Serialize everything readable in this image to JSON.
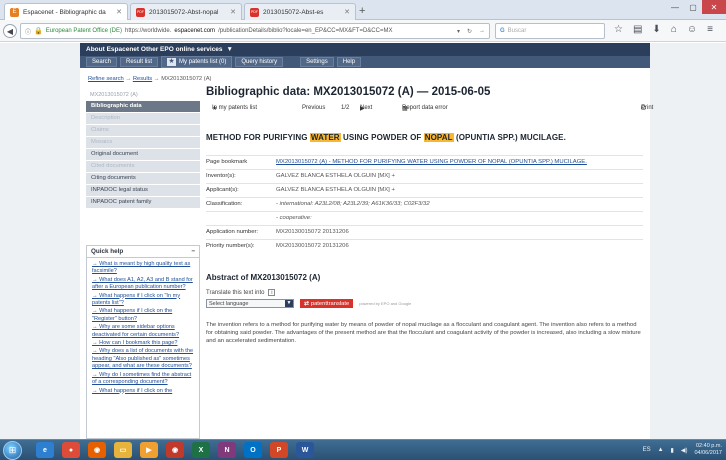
{
  "browser": {
    "tabs": [
      {
        "title": "Espacenet - Bibliographic da",
        "favicon_color": "#e67e22",
        "favicon_letter": "E"
      },
      {
        "title": "2013015072-Abst-nopal",
        "favicon_color": "#d8322b",
        "favicon_letter": "PDF"
      },
      {
        "title": "2013015072-Abst-es",
        "favicon_color": "#d8322b",
        "favicon_letter": "PDF"
      }
    ],
    "new_tab": "+",
    "address": {
      "org": "European Patent Office (DE)",
      "prefix": "https://worldwide.",
      "host": "espacenet.com",
      "rest": "/publicationDetails/biblio?locale=en_EP&CC=MX&FT=D&CC=MX"
    },
    "search_placeholder": "Buscar",
    "search_engine_glyph": "G",
    "toolbar_icons": [
      "☆",
      "▤",
      "⬇",
      "⌂",
      "☺",
      "≡"
    ]
  },
  "espacenet": {
    "top_menu": "About Espacenet   Other EPO online services",
    "sub_menu": [
      "Search",
      "Result list",
      "My patents list (0)",
      "Query history",
      "Settings",
      "Help"
    ],
    "breadcrumb": {
      "refine": "Refine search",
      "results": "Results",
      "current": "MX2013015072 (A)"
    },
    "sidebar": {
      "heading": "MX2013015072 (A)",
      "items": [
        {
          "label": "Bibliographic data",
          "state": "active"
        },
        {
          "label": "Description",
          "state": "disabled"
        },
        {
          "label": "Claims",
          "state": "disabled"
        },
        {
          "label": "Mosaics",
          "state": "disabled"
        },
        {
          "label": "Original document",
          "state": "normal"
        },
        {
          "label": "Cited documents",
          "state": "disabled"
        },
        {
          "label": "Citing documents",
          "state": "normal"
        },
        {
          "label": "INPADOC legal status",
          "state": "normal"
        },
        {
          "label": "INPADOC patent family",
          "state": "normal"
        }
      ]
    },
    "quick_help": {
      "title": "Quick help",
      "collapse": "−",
      "links": [
        "What is meant by high quality text as facsimile?",
        "What does A1, A2, A3 and B stand for after a European publication number?",
        "What happens if I click on \"In my patents list\"?",
        "What happens if I click on the \"Register\" button?",
        "Why are some sidebar options deactivated for certain documents?",
        "How can I bookmark this page?",
        "Why does a list of documents with the heading \"Also published as\" sometimes appear, and what are these documents?",
        "Why do I sometimes find the abstract of a corresponding document?",
        "What happens if I click on the"
      ]
    },
    "page_title": "Bibliographic data: MX2013015072 (A) — 2015-06-05",
    "actions": {
      "add_to_list": "In my patents list",
      "previous": "Previous",
      "pager": "1/2",
      "next": "Next",
      "report": "Report data error",
      "print": "Print"
    },
    "invention_title": {
      "part1": "METHOD FOR PURIFYING ",
      "hl1": "WATER",
      "part2": " USING POWDER OF ",
      "hl2": "NOPAL",
      "part3": " (OPUNTIA SPP.) MUCILAGE."
    },
    "fields": [
      {
        "label": "Page bookmark",
        "value": "MX2013015072 (A)  -  METHOD FOR PURIFYING WATER USING POWDER OF NOPAL (OPUNTIA SPP.) MUCILAGE.",
        "style": "link"
      },
      {
        "label": "Inventor(s):",
        "value": "GÁLVEZ BLANCA ESTHELA OLGUÍN  [MX] +",
        "style": "plain"
      },
      {
        "label": "Applicant(s):",
        "value": "GÁLVEZ BLANCA ESTHELA OLGUÍN  [MX] +",
        "style": "plain"
      },
      {
        "label": "Classification:",
        "value": "- international:   A23L2/08; A23L2/39; A61K36/33; C02F3/32",
        "style": "ital"
      },
      {
        "label": "",
        "value": "- cooperative:",
        "style": "ital"
      },
      {
        "label": "Application number:",
        "value": "MX20130015072 20131206",
        "style": "plain"
      },
      {
        "label": "Priority number(s):",
        "value": "MX20130015072 20131206",
        "style": "plain"
      }
    ],
    "abstract": {
      "title": "Abstract of  MX2013015072 (A)",
      "translate_label": "Translate this text into",
      "help_glyph": "i",
      "select_placeholder": "Select language",
      "patenttranslate": "patenttranslate",
      "powered_by": "powered by EPO and Google",
      "text": "The invention refers to a method for purifying water by means of powder of nopal mucilage as a flocculant and coagulant agent. The invention also refers to a method for obtaining said powder. The advantages of the present method are that the flocculant and coagulant activity of the powder is increased, also including a slow mixture and an accelerated sedimentation."
    }
  },
  "taskbar": {
    "apps": [
      {
        "name": "ie",
        "color": "#2f7fd0",
        "glyph": "e"
      },
      {
        "name": "chrome",
        "color": "#dd4b39",
        "glyph": "●"
      },
      {
        "name": "firefox",
        "color": "#e66000",
        "glyph": "◉"
      },
      {
        "name": "explorer",
        "color": "#e6b43c",
        "glyph": "▭"
      },
      {
        "name": "media",
        "color": "#f0a030",
        "glyph": "▶"
      },
      {
        "name": "firefox2",
        "color": "#c0392b",
        "glyph": "◉"
      },
      {
        "name": "excel",
        "color": "#1e7145",
        "glyph": "X"
      },
      {
        "name": "onenote",
        "color": "#80397b",
        "glyph": "N"
      },
      {
        "name": "outlook",
        "color": "#0072c6",
        "glyph": "O"
      },
      {
        "name": "powerpoint",
        "color": "#d24726",
        "glyph": "P"
      },
      {
        "name": "word",
        "color": "#2b579a",
        "glyph": "W"
      }
    ],
    "tray_lang": "ES",
    "clock_time": "02:40 p.m.",
    "clock_date": "04/06/2017"
  }
}
